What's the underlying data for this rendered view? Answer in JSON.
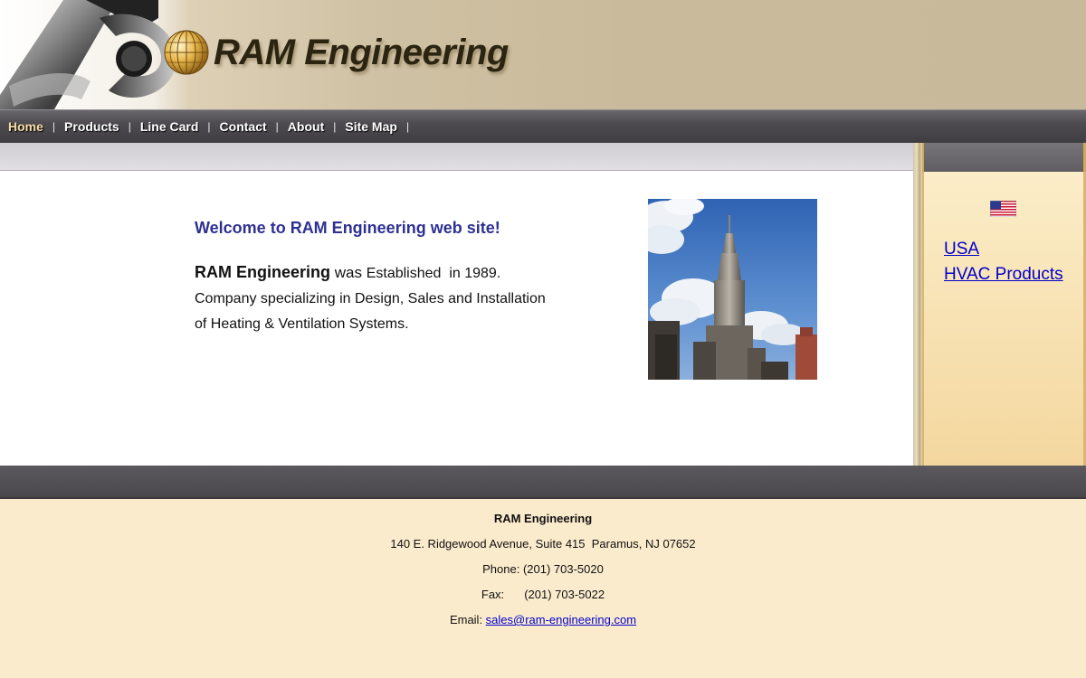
{
  "header": {
    "brand": "RAM Engineering"
  },
  "nav": {
    "items": [
      {
        "label": "Home",
        "active": true
      },
      {
        "label": "Products"
      },
      {
        "label": "Line Card"
      },
      {
        "label": "Contact"
      },
      {
        "label": "About"
      },
      {
        "label": "Site Map"
      }
    ],
    "separator": "|"
  },
  "main": {
    "welcome": "Welcome to RAM Engineering web site!",
    "intro_brand": "RAM Engineering",
    "intro_was": " was ",
    "intro_established": "Established",
    "intro_year": "  in 1989.",
    "intro_line2": "Company specializing in Design, Sales and Installation",
    "intro_line3": "of Heating & Ventilation Systems."
  },
  "sidebar": {
    "links": [
      {
        "label": "USA"
      },
      {
        "label": "HVAC Products"
      }
    ]
  },
  "footer": {
    "name": "RAM Engineering",
    "address": "140 E. Ridgewood Avenue, Suite 415  Paramus, NJ 07652",
    "phone": "Phone: (201) 703-5020",
    "fax_label": "Fax:",
    "fax_number": "(201) 703-5022",
    "email_label": "Email: ",
    "email": "sales@ram-engineering.com"
  },
  "colors": {
    "welcome_text": "#2e3192",
    "link": "#0000cc",
    "nav_active": "#f4dba4",
    "footer_bg": "#fbebcd"
  }
}
